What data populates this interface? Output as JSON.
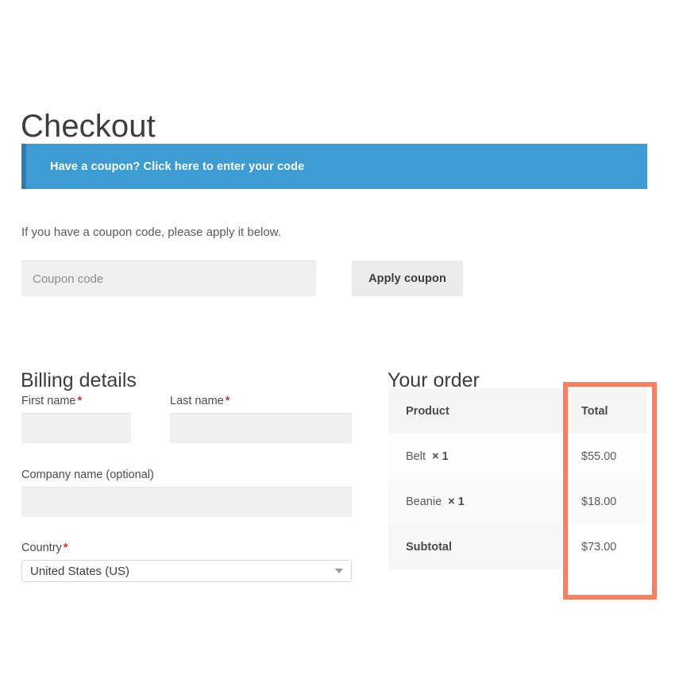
{
  "page": {
    "title": "Checkout"
  },
  "coupon_notice": {
    "text": "Have a coupon? Click here to enter your code",
    "bar_color": "#3d9cd2",
    "accent_color": "#2e7cac"
  },
  "coupon_form": {
    "help_text": "If you have a coupon code, please apply it below.",
    "input_placeholder": "Coupon code",
    "input_value": "",
    "apply_label": "Apply coupon"
  },
  "billing": {
    "heading": "Billing details",
    "required_marker": "*",
    "fields": [
      {
        "label": "First name",
        "required": true,
        "value": ""
      },
      {
        "label": "Last name",
        "required": true,
        "value": ""
      },
      {
        "label": "Company name (optional)",
        "required": false,
        "value": ""
      },
      {
        "label": "Country",
        "required": true,
        "value": "United States (US)"
      }
    ]
  },
  "order": {
    "heading": "Your order",
    "columns": [
      "Product",
      "Total"
    ],
    "items": [
      {
        "name": "Belt",
        "qty": "× 1",
        "total": "$55.00"
      },
      {
        "name": "Beanie",
        "qty": "× 1",
        "total": "$18.00"
      }
    ],
    "subtotal": {
      "label": "Subtotal",
      "value": "$73.00"
    }
  },
  "annotation": {
    "color": "#fa7f60",
    "target": "total-column"
  }
}
